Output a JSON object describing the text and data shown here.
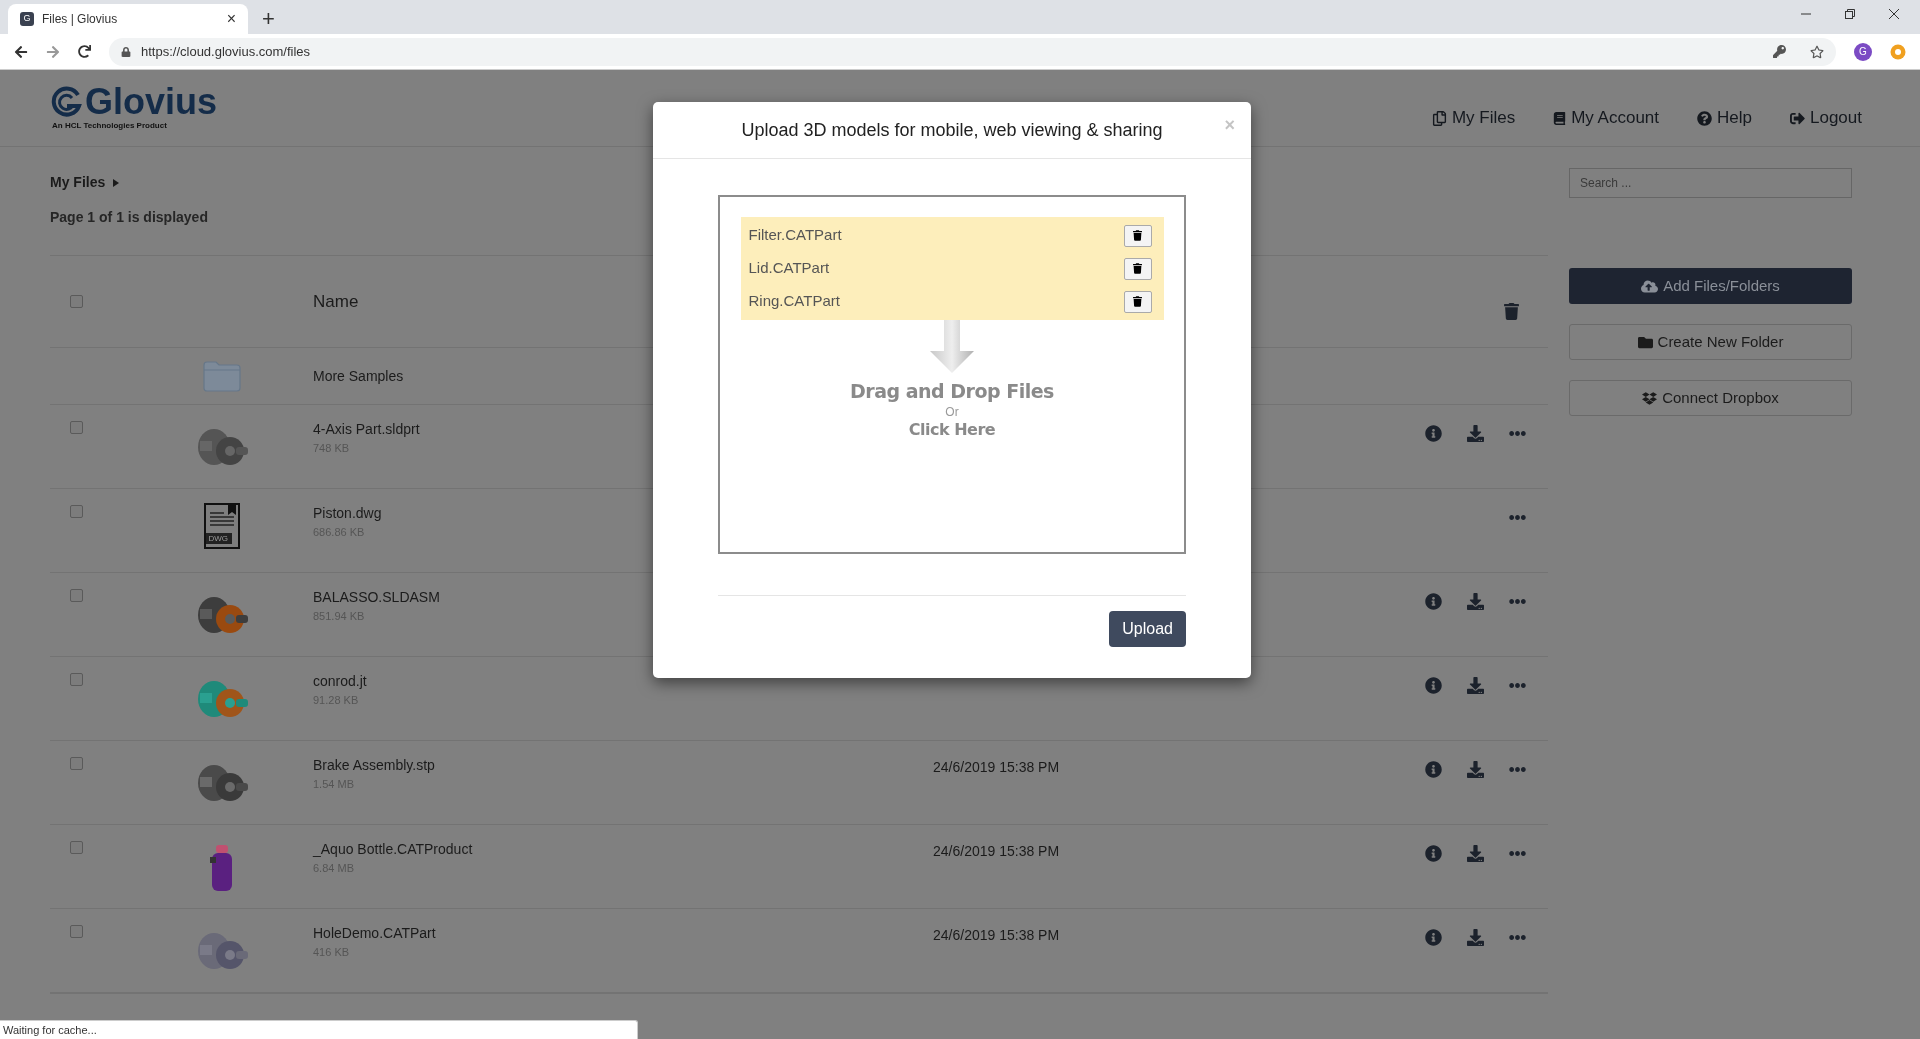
{
  "browser": {
    "tab_title": "Files | Glovius",
    "tab_favicon": "G",
    "tab_close": "×",
    "new_tab": "+",
    "url": "https://cloud.glovius.com/files",
    "profile": "G"
  },
  "header": {
    "logo": "Glovius",
    "tagline": "An HCL Technologies Product",
    "nav": [
      {
        "kind": "files",
        "label": "My Files"
      },
      {
        "kind": "account",
        "label": "My Account"
      },
      {
        "kind": "help",
        "label": "Help"
      },
      {
        "kind": "logout",
        "label": "Logout"
      }
    ]
  },
  "breadcrumb": "My Files",
  "page_info": "Page 1 of 1 is displayed",
  "table": {
    "select_all_checked": false,
    "columns": [
      "Name"
    ],
    "rows": [
      {
        "name": "More Samples",
        "kind": "folder"
      },
      {
        "name": "4-Axis Part.sldprt",
        "size": "748 KB",
        "kind": "picture",
        "checked": false,
        "actions": [
          {
            "kind": "info"
          },
          {
            "kind": "download"
          },
          {
            "kind": "more"
          }
        ]
      },
      {
        "name": "Piston.dwg",
        "size": "686.86 KB",
        "kind": "document",
        "thumb_label": "DWG",
        "checked": false,
        "actions": [
          {
            "kind": "more"
          }
        ]
      },
      {
        "name": "BALASSO.SLDASM",
        "size": "851.94 KB",
        "kind": "picture",
        "checked": false,
        "actions": [
          {
            "kind": "info"
          },
          {
            "kind": "download"
          },
          {
            "kind": "more"
          }
        ]
      },
      {
        "name": "conrod.jt",
        "size": "91.28 KB",
        "kind": "picture",
        "checked": false,
        "actions": [
          {
            "kind": "info"
          },
          {
            "kind": "download"
          },
          {
            "kind": "more"
          }
        ]
      },
      {
        "name": "Brake Assembly.stp",
        "size": "1.54 MB",
        "kind": "picture",
        "date": "24/6/2019 15:38 PM",
        "checked": false,
        "actions": [
          {
            "kind": "info"
          },
          {
            "kind": "download"
          },
          {
            "kind": "more"
          }
        ]
      },
      {
        "name": "_Aquo Bottle.CATProduct",
        "size": "6.84 MB",
        "kind": "picture",
        "date": "24/6/2019 15:38 PM",
        "checked": false,
        "actions": [
          {
            "kind": "info"
          },
          {
            "kind": "download"
          },
          {
            "kind": "more"
          }
        ]
      },
      {
        "name": "HoleDemo.CATPart",
        "size": "416 KB",
        "kind": "picture",
        "date": "24/6/2019 15:38 PM",
        "checked": false,
        "actions": [
          {
            "kind": "info"
          },
          {
            "kind": "download"
          },
          {
            "kind": "more"
          }
        ]
      }
    ]
  },
  "sidebar": {
    "search": {
      "placeholder": "Search ..."
    },
    "buttons": [
      {
        "kind": "upload",
        "label": "Add Files/Folders",
        "primary": true
      },
      {
        "kind": "folder",
        "label": "Create New Folder",
        "primary": false
      },
      {
        "kind": "dropbox",
        "label": "Connect Dropbox",
        "primary": false
      }
    ]
  },
  "dialog": {
    "title": "Upload 3D models for mobile, web viewing & sharing",
    "close": "×",
    "files": [
      "Filter.CATPart",
      "Lid.CATPart",
      "Ring.CATPart"
    ],
    "drop_title": "Drag and Drop Files",
    "drop_or": "Or",
    "drop_click": "Click Here",
    "upload_button": "Upload"
  },
  "status_bar": "Waiting for cache..."
}
